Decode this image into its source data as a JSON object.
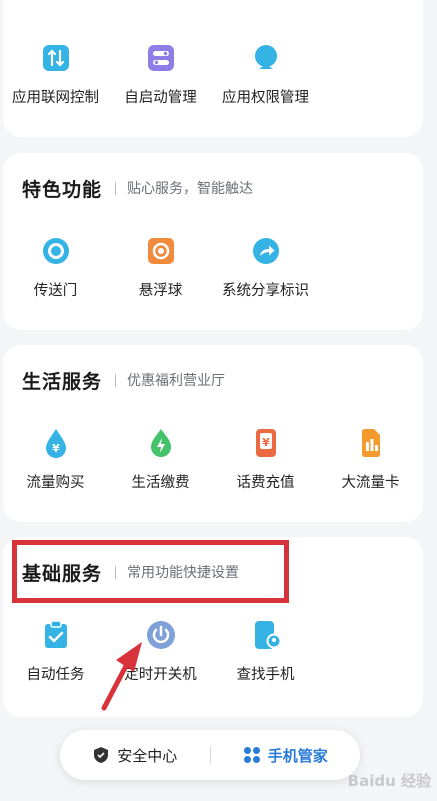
{
  "card_top": {
    "items": [
      {
        "label": "应用联网控制",
        "icon": "network-toggle-icon"
      },
      {
        "label": "自启动管理",
        "icon": "autostart-icon"
      },
      {
        "label": "应用权限管理",
        "icon": "permission-icon"
      }
    ]
  },
  "card_features": {
    "title": "特色功能",
    "subtitle": "贴心服务，智能触达",
    "items": [
      {
        "label": "传送门",
        "icon": "portal-icon"
      },
      {
        "label": "悬浮球",
        "icon": "floating-ball-icon"
      },
      {
        "label": "系统分享标识",
        "icon": "share-icon"
      }
    ]
  },
  "card_life": {
    "title": "生活服务",
    "subtitle": "优惠福利营业厅",
    "items": [
      {
        "label": "流量购买",
        "icon": "data-purchase-icon"
      },
      {
        "label": "生活缴费",
        "icon": "utility-payment-icon"
      },
      {
        "label": "话费充值",
        "icon": "phone-recharge-icon"
      },
      {
        "label": "大流量卡",
        "icon": "sim-card-icon"
      }
    ]
  },
  "card_basic": {
    "title": "基础服务",
    "subtitle": "常用功能快捷设置",
    "items": [
      {
        "label": "自动任务",
        "icon": "auto-task-icon"
      },
      {
        "label": "定时开关机",
        "icon": "power-icon"
      },
      {
        "label": "查找手机",
        "icon": "find-phone-icon"
      }
    ]
  },
  "bottom_nav": {
    "left_label": "安全中心",
    "right_label": "手机管家"
  },
  "watermark": "Baidu 经验",
  "colors": {
    "accent_blue": "#2a7bd8",
    "highlight_red": "#d8323a",
    "card_bg": "#ffffff",
    "page_bg": "#f4f5f7"
  }
}
